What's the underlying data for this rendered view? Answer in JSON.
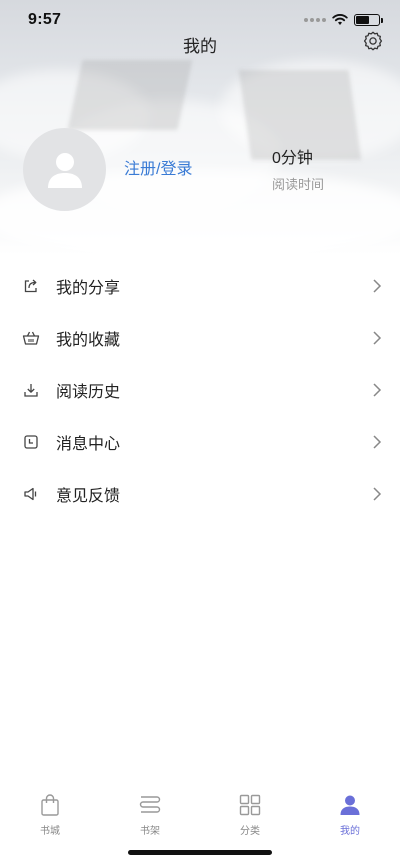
{
  "status_bar": {
    "time": "9:57",
    "battery_level": 0.6
  },
  "header": {
    "title": "我的",
    "settings_icon": "gear-icon"
  },
  "profile": {
    "avatar_icon": "user-avatar-icon",
    "login_label": "注册/登录",
    "reading_time_value": "0分钟",
    "reading_time_label": "阅读时间"
  },
  "menu": {
    "items": [
      {
        "label": "我的分享",
        "icon": "share-icon"
      },
      {
        "label": "我的收藏",
        "icon": "favorites-basket-icon"
      },
      {
        "label": "阅读历史",
        "icon": "download-history-icon"
      },
      {
        "label": "消息中心",
        "icon": "message-center-icon"
      },
      {
        "label": "意见反馈",
        "icon": "feedback-speaker-icon"
      }
    ]
  },
  "tab_bar": {
    "tabs": [
      {
        "label": "书城",
        "icon": "bookstore-bag-icon",
        "active": false
      },
      {
        "label": "书架",
        "icon": "bookshelf-icon",
        "active": false
      },
      {
        "label": "分类",
        "icon": "category-grid-icon",
        "active": false
      },
      {
        "label": "我的",
        "icon": "profile-person-icon",
        "active": true
      }
    ]
  },
  "colors": {
    "accent": "#3a7bd5",
    "active_tab": "#6a6fd8",
    "muted": "#999999"
  }
}
